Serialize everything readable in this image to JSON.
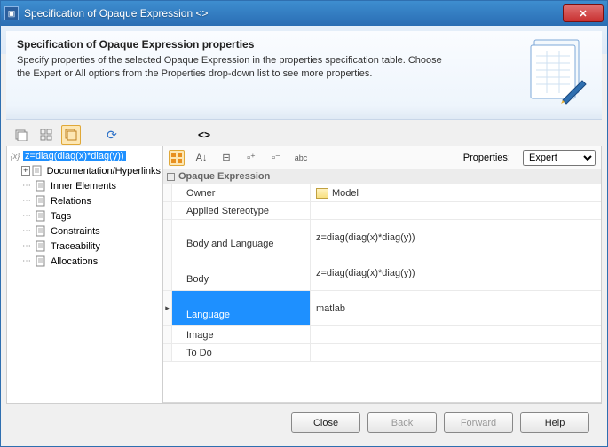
{
  "window": {
    "title": "Specification of Opaque Expression <>"
  },
  "header": {
    "heading": "Specification of Opaque Expression properties",
    "description": "Specify properties of the selected Opaque Expression in the properties specification table. Choose the Expert or All options from the Properties drop-down list to see more properties."
  },
  "toolbar": {
    "object_symbol": "<>"
  },
  "tree": {
    "root_label": "z=diag(diag(x)*diag(y))",
    "items": [
      "Documentation/Hyperlinks",
      "Inner Elements",
      "Relations",
      "Tags",
      "Constraints",
      "Traceability",
      "Allocations"
    ],
    "doc_expandable": true
  },
  "properties": {
    "dropdown_label": "Properties:",
    "dropdown_value": "Expert",
    "group": "Opaque Expression",
    "rows": [
      {
        "name": "Owner",
        "value": "Model",
        "icon": "model",
        "selected": false,
        "tall": false
      },
      {
        "name": "Applied Stereotype",
        "value": "",
        "selected": false,
        "tall": false
      },
      {
        "name": "Body and Language",
        "value": "z=diag(diag(x)*diag(y))",
        "selected": false,
        "tall": true
      },
      {
        "name": "Body",
        "value": "z=diag(diag(x)*diag(y))",
        "selected": false,
        "tall": true
      },
      {
        "name": "Language",
        "value": "matlab",
        "selected": true,
        "tall": true
      },
      {
        "name": "Image",
        "value": "",
        "selected": false,
        "tall": false
      },
      {
        "name": "To Do",
        "value": "",
        "selected": false,
        "tall": false
      }
    ]
  },
  "buttons": {
    "close": "Close",
    "back": "Back",
    "forward": "Forward",
    "help": "Help"
  }
}
